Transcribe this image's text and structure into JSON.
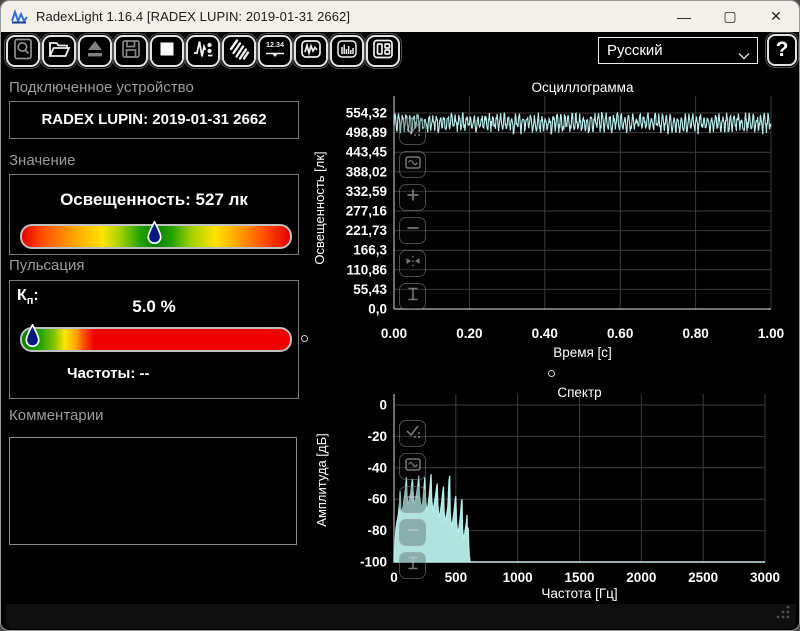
{
  "window": {
    "title": "RadexLight 1.16.4 [RADEX LUPIN: 2019-01-31 2662]",
    "minimize": "—",
    "maximize": "▢",
    "close": "✕"
  },
  "toolbar": {
    "language": "Русский",
    "help": "?",
    "buttons": [
      "search-icon",
      "open-folder-icon",
      "eject-icon",
      "save-icon",
      "stop-icon",
      "pulse-settings-icon",
      "sweep-icon",
      "numeric-display-icon",
      "oscillogram-icon",
      "spectrum-icon",
      "layout-icon"
    ]
  },
  "panels": {
    "device": {
      "label": "Подключенное устройство",
      "value": "RADEX LUPIN: 2019-01-31 2662"
    },
    "value": {
      "label": "Значение",
      "reading": "Освещенность: 527 лк",
      "marker_pct": 50,
      "gradient": [
        [
          "0%",
          "#e80000"
        ],
        [
          "8%",
          "#ff5200"
        ],
        [
          "20%",
          "#ffa800"
        ],
        [
          "30%",
          "#ffe400"
        ],
        [
          "37%",
          "#a0cf00"
        ],
        [
          "44%",
          "#23a400"
        ],
        [
          "50%",
          "#0b7e00"
        ],
        [
          "56%",
          "#23a400"
        ],
        [
          "63%",
          "#a0cf00"
        ],
        [
          "72%",
          "#ffe400"
        ],
        [
          "80%",
          "#ffa800"
        ],
        [
          "90%",
          "#ff5200"
        ],
        [
          "100%",
          "#e80000"
        ]
      ]
    },
    "pulsation": {
      "label": "Пульсация",
      "kp_base": "К",
      "kp_sub": "п",
      "kp_colon": ":",
      "kp_value": "5.0 %",
      "frequencies": "Частоты: --",
      "marker_pct": 4.8,
      "gradient": [
        [
          "0%",
          "#0b7e00"
        ],
        [
          "7%",
          "#23a400"
        ],
        [
          "12%",
          "#86c300"
        ],
        [
          "16%",
          "#ffe400"
        ],
        [
          "20%",
          "#ffa800"
        ],
        [
          "23%",
          "#ff4e00"
        ],
        [
          "27%",
          "#f00000"
        ],
        [
          "100%",
          "#f00000"
        ]
      ]
    },
    "comments": {
      "label": "Комментарии",
      "text": ""
    }
  },
  "chart_tools": {
    "top": [
      "auto-scale-icon",
      "frame-icon",
      "zoom-in-icon",
      "zoom-out-icon",
      "fit-horizontal-icon",
      "fit-vertical-icon"
    ],
    "bottom": [
      "auto-scale-icon",
      "frame-icon",
      "zoom-in-icon",
      "zoom-out-icon",
      "fit-vertical-icon"
    ]
  },
  "chart_data": [
    {
      "type": "line",
      "title": "Осциллограмма",
      "xlabel": "Время [с]",
      "ylabel": "Освещенность [лк]",
      "xlim": [
        0,
        1
      ],
      "ylim": [
        0,
        610
      ],
      "grid": true,
      "line_color": "#b6efec",
      "xticks": [
        {
          "label": "0.00",
          "v": 0
        },
        {
          "label": "0.20",
          "v": 0.2
        },
        {
          "label": "0.40",
          "v": 0.4
        },
        {
          "label": "0.60",
          "v": 0.6
        },
        {
          "label": "0.80",
          "v": 0.8
        },
        {
          "label": "1.00",
          "v": 1.0
        }
      ],
      "yticks": [
        {
          "label": "554,32",
          "v": 554.32
        },
        {
          "label": "498,89",
          "v": 498.89
        },
        {
          "label": "443,45",
          "v": 443.45
        },
        {
          "label": "388,02",
          "v": 388.02
        },
        {
          "label": "332,59",
          "v": 332.59
        },
        {
          "label": "277,16",
          "v": 277.16
        },
        {
          "label": "221,73",
          "v": 221.73
        },
        {
          "label": "166,3",
          "v": 166.3
        },
        {
          "label": "110,86",
          "v": 110.86
        },
        {
          "label": "55,43",
          "v": 55.43
        },
        {
          "label": "0,0",
          "v": 0
        }
      ],
      "series": [
        {
          "name": "освещенность",
          "mean": 527,
          "amplitude": 18,
          "noise": 24,
          "cycles": 100,
          "min": 494,
          "max": 557,
          "samples": 740,
          "seed": 20190131
        }
      ]
    },
    {
      "type": "area",
      "title": "Спектр",
      "xlabel": "Частота [Гц]",
      "ylabel": "Амплитуда [дБ]",
      "xlim": [
        0,
        3000
      ],
      "ylim": [
        -100,
        0
      ],
      "grid": true,
      "line_color": "#b6efec",
      "fill_color": "#b9efeb",
      "xticks": [
        {
          "label": "0",
          "v": 0
        },
        {
          "label": "500",
          "v": 500
        },
        {
          "label": "1000",
          "v": 1000
        },
        {
          "label": "1500",
          "v": 1500
        },
        {
          "label": "2000",
          "v": 2000
        },
        {
          "label": "2500",
          "v": 2500
        },
        {
          "label": "3000",
          "v": 3000
        }
      ],
      "yticks": [
        {
          "label": "0",
          "v": 0
        },
        {
          "label": "-20",
          "v": -20
        },
        {
          "label": "-40",
          "v": -40
        },
        {
          "label": "-60",
          "v": -60
        },
        {
          "label": "-80",
          "v": -80
        },
        {
          "label": "-100",
          "v": -100
        }
      ],
      "series": [
        {
          "name": "амплитуда",
          "points": [
            [
              0,
              -100
            ],
            [
              8,
              -88
            ],
            [
              15,
              -79
            ],
            [
              25,
              -74
            ],
            [
              35,
              -70
            ],
            [
              45,
              -62
            ],
            [
              50,
              -55
            ],
            [
              55,
              -66
            ],
            [
              65,
              -68
            ],
            [
              75,
              -64
            ],
            [
              85,
              -58
            ],
            [
              95,
              -52
            ],
            [
              100,
              -46
            ],
            [
              105,
              -58
            ],
            [
              115,
              -64
            ],
            [
              125,
              -60
            ],
            [
              135,
              -56
            ],
            [
              145,
              -50
            ],
            [
              150,
              -47
            ],
            [
              155,
              -58
            ],
            [
              165,
              -64
            ],
            [
              175,
              -60
            ],
            [
              185,
              -55
            ],
            [
              195,
              -50
            ],
            [
              200,
              -45
            ],
            [
              205,
              -57
            ],
            [
              215,
              -63
            ],
            [
              225,
              -66
            ],
            [
              235,
              -60
            ],
            [
              245,
              -50
            ],
            [
              250,
              -46
            ],
            [
              255,
              -60
            ],
            [
              265,
              -68
            ],
            [
              275,
              -64
            ],
            [
              285,
              -58
            ],
            [
              295,
              -48
            ],
            [
              300,
              -44
            ],
            [
              305,
              -60
            ],
            [
              315,
              -68
            ],
            [
              325,
              -63
            ],
            [
              335,
              -58
            ],
            [
              345,
              -52
            ],
            [
              350,
              -50
            ],
            [
              355,
              -64
            ],
            [
              365,
              -72
            ],
            [
              375,
              -68
            ],
            [
              385,
              -62
            ],
            [
              395,
              -55
            ],
            [
              400,
              -52
            ],
            [
              405,
              -68
            ],
            [
              415,
              -75
            ],
            [
              425,
              -70
            ],
            [
              435,
              -65
            ],
            [
              445,
              -48
            ],
            [
              450,
              -45
            ],
            [
              455,
              -70
            ],
            [
              465,
              -78
            ],
            [
              475,
              -74
            ],
            [
              485,
              -68
            ],
            [
              495,
              -60
            ],
            [
              500,
              -58
            ],
            [
              505,
              -74
            ],
            [
              515,
              -82
            ],
            [
              525,
              -78
            ],
            [
              535,
              -72
            ],
            [
              545,
              -62
            ],
            [
              550,
              -60
            ],
            [
              555,
              -80
            ],
            [
              565,
              -86
            ],
            [
              575,
              -80
            ],
            [
              585,
              -75
            ],
            [
              590,
              -70
            ],
            [
              595,
              -85
            ],
            [
              600,
              -78
            ],
            [
              605,
              -90
            ],
            [
              610,
              -96
            ],
            [
              615,
              -100
            ],
            [
              3000,
              -100
            ]
          ]
        }
      ]
    }
  ]
}
